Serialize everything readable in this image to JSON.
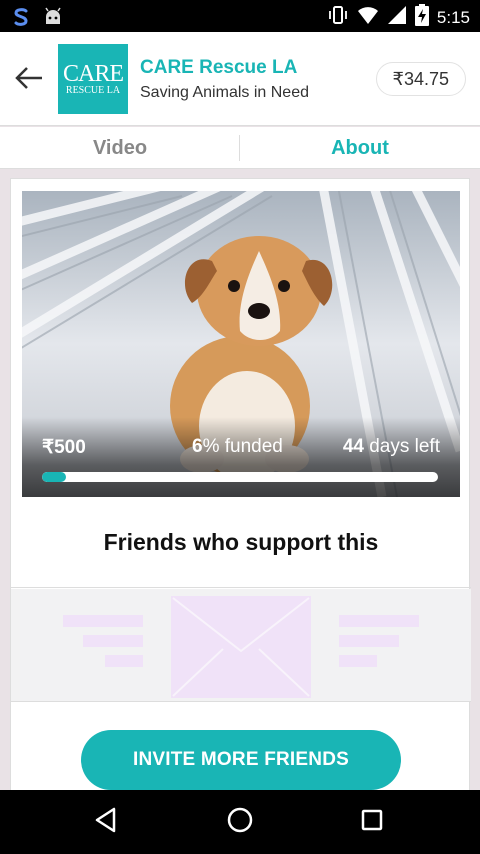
{
  "status_bar": {
    "time": "5:15",
    "icons": [
      "s-app-icon",
      "android-icon",
      "vibrate-icon",
      "wifi-icon",
      "signal-icon",
      "battery-charging-icon"
    ]
  },
  "header": {
    "back_icon": "back-arrow-icon",
    "logo_line1": "CARE",
    "logo_line2": "RESCUE LA",
    "title": "CARE Rescue LA",
    "subtitle": "Saving Animals in Need",
    "balance": "₹34.75"
  },
  "tabs": [
    {
      "label": "Video",
      "active": false
    },
    {
      "label": "About",
      "active": true
    }
  ],
  "campaign": {
    "goal": "₹500",
    "funded_value": "6",
    "funded_suffix": "% funded",
    "days_value": "44",
    "days_suffix": "days left",
    "progress_percent": 6
  },
  "friends": {
    "title": "Friends who support this",
    "illustration_icon": "envelope-icon"
  },
  "invite": {
    "label": "INVITE MORE FRIENDS"
  },
  "nav_bar": {
    "icons": [
      "nav-back-icon",
      "nav-home-icon",
      "nav-recents-icon"
    ]
  },
  "colors": {
    "accent": "#19b5b5",
    "illustration": "#f0e3f7",
    "background": "#e9e2e6"
  }
}
